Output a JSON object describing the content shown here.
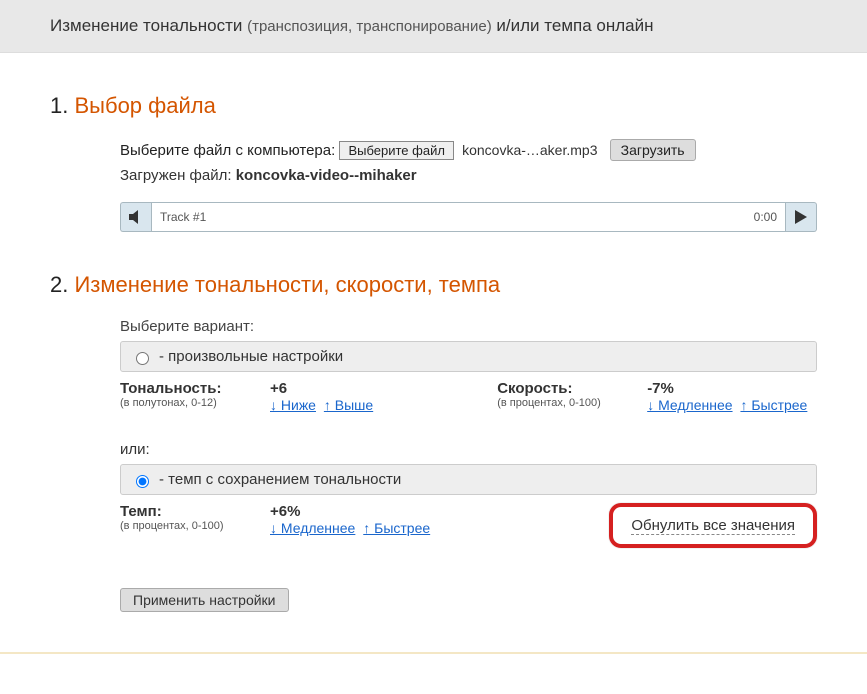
{
  "header": {
    "title_main": "Изменение тональности ",
    "title_sub": "(транспозиция, транспонирование)",
    "title_tail": " и/или темпа онлайн"
  },
  "section1": {
    "num": "1.",
    "title": "Выбор файла",
    "choose_label": "Выберите файл с компьютера:",
    "choose_btn": "Выберите файл",
    "chosen_filename": "koncovka-…aker.mp3",
    "upload_btn": "Загрузить",
    "loaded_prefix": "Загружен файл: ",
    "loaded_name": "koncovka-video--mihaker",
    "player": {
      "track_label": "Track #1",
      "time": "0:00"
    }
  },
  "section2": {
    "num": "2.",
    "title": "Изменение тональности, скорости, темпа",
    "choose_variant": "Выберите вариант:",
    "opt_custom": "- произвольные настройки",
    "pitch": {
      "label": "Тональность:",
      "hint": "(в полутонах, 0-12)",
      "value": "+6",
      "lower": "↓ Ниже",
      "higher": "↑ Выше"
    },
    "speed": {
      "label": "Скорость:",
      "hint": "(в процентах, 0-100)",
      "value": "-7%",
      "slower": "↓ Медленнее",
      "faster": "↑ Быстрее"
    },
    "or": "или:",
    "opt_tempo": "- темп с сохранением тональности",
    "tempo": {
      "label": "Темп:",
      "hint": "(в процентах, 0-100)",
      "value": "+6%",
      "slower": "↓ Медленнее",
      "faster": "↑ Быстрее"
    },
    "reset": "Обнулить все значения",
    "apply": "Применить настройки"
  }
}
